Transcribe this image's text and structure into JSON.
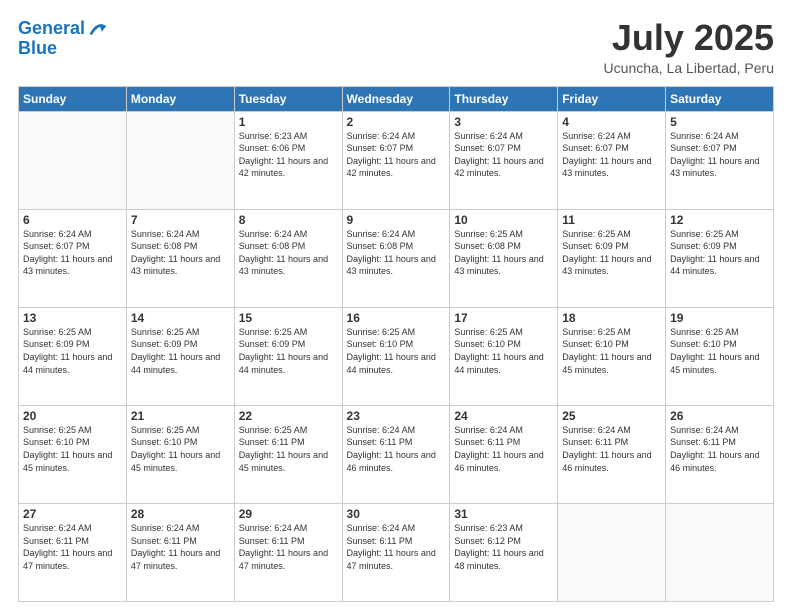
{
  "header": {
    "logo_line1": "General",
    "logo_line2": "Blue",
    "month_title": "July 2025",
    "location": "Ucuncha, La Libertad, Peru"
  },
  "weekdays": [
    "Sunday",
    "Monday",
    "Tuesday",
    "Wednesday",
    "Thursday",
    "Friday",
    "Saturday"
  ],
  "weeks": [
    [
      {
        "day": "",
        "sunrise": "",
        "sunset": "",
        "daylight": ""
      },
      {
        "day": "",
        "sunrise": "",
        "sunset": "",
        "daylight": ""
      },
      {
        "day": "1",
        "sunrise": "Sunrise: 6:23 AM",
        "sunset": "Sunset: 6:06 PM",
        "daylight": "Daylight: 11 hours and 42 minutes."
      },
      {
        "day": "2",
        "sunrise": "Sunrise: 6:24 AM",
        "sunset": "Sunset: 6:07 PM",
        "daylight": "Daylight: 11 hours and 42 minutes."
      },
      {
        "day": "3",
        "sunrise": "Sunrise: 6:24 AM",
        "sunset": "Sunset: 6:07 PM",
        "daylight": "Daylight: 11 hours and 42 minutes."
      },
      {
        "day": "4",
        "sunrise": "Sunrise: 6:24 AM",
        "sunset": "Sunset: 6:07 PM",
        "daylight": "Daylight: 11 hours and 43 minutes."
      },
      {
        "day": "5",
        "sunrise": "Sunrise: 6:24 AM",
        "sunset": "Sunset: 6:07 PM",
        "daylight": "Daylight: 11 hours and 43 minutes."
      }
    ],
    [
      {
        "day": "6",
        "sunrise": "Sunrise: 6:24 AM",
        "sunset": "Sunset: 6:07 PM",
        "daylight": "Daylight: 11 hours and 43 minutes."
      },
      {
        "day": "7",
        "sunrise": "Sunrise: 6:24 AM",
        "sunset": "Sunset: 6:08 PM",
        "daylight": "Daylight: 11 hours and 43 minutes."
      },
      {
        "day": "8",
        "sunrise": "Sunrise: 6:24 AM",
        "sunset": "Sunset: 6:08 PM",
        "daylight": "Daylight: 11 hours and 43 minutes."
      },
      {
        "day": "9",
        "sunrise": "Sunrise: 6:24 AM",
        "sunset": "Sunset: 6:08 PM",
        "daylight": "Daylight: 11 hours and 43 minutes."
      },
      {
        "day": "10",
        "sunrise": "Sunrise: 6:25 AM",
        "sunset": "Sunset: 6:08 PM",
        "daylight": "Daylight: 11 hours and 43 minutes."
      },
      {
        "day": "11",
        "sunrise": "Sunrise: 6:25 AM",
        "sunset": "Sunset: 6:09 PM",
        "daylight": "Daylight: 11 hours and 43 minutes."
      },
      {
        "day": "12",
        "sunrise": "Sunrise: 6:25 AM",
        "sunset": "Sunset: 6:09 PM",
        "daylight": "Daylight: 11 hours and 44 minutes."
      }
    ],
    [
      {
        "day": "13",
        "sunrise": "Sunrise: 6:25 AM",
        "sunset": "Sunset: 6:09 PM",
        "daylight": "Daylight: 11 hours and 44 minutes."
      },
      {
        "day": "14",
        "sunrise": "Sunrise: 6:25 AM",
        "sunset": "Sunset: 6:09 PM",
        "daylight": "Daylight: 11 hours and 44 minutes."
      },
      {
        "day": "15",
        "sunrise": "Sunrise: 6:25 AM",
        "sunset": "Sunset: 6:09 PM",
        "daylight": "Daylight: 11 hours and 44 minutes."
      },
      {
        "day": "16",
        "sunrise": "Sunrise: 6:25 AM",
        "sunset": "Sunset: 6:10 PM",
        "daylight": "Daylight: 11 hours and 44 minutes."
      },
      {
        "day": "17",
        "sunrise": "Sunrise: 6:25 AM",
        "sunset": "Sunset: 6:10 PM",
        "daylight": "Daylight: 11 hours and 44 minutes."
      },
      {
        "day": "18",
        "sunrise": "Sunrise: 6:25 AM",
        "sunset": "Sunset: 6:10 PM",
        "daylight": "Daylight: 11 hours and 45 minutes."
      },
      {
        "day": "19",
        "sunrise": "Sunrise: 6:25 AM",
        "sunset": "Sunset: 6:10 PM",
        "daylight": "Daylight: 11 hours and 45 minutes."
      }
    ],
    [
      {
        "day": "20",
        "sunrise": "Sunrise: 6:25 AM",
        "sunset": "Sunset: 6:10 PM",
        "daylight": "Daylight: 11 hours and 45 minutes."
      },
      {
        "day": "21",
        "sunrise": "Sunrise: 6:25 AM",
        "sunset": "Sunset: 6:10 PM",
        "daylight": "Daylight: 11 hours and 45 minutes."
      },
      {
        "day": "22",
        "sunrise": "Sunrise: 6:25 AM",
        "sunset": "Sunset: 6:11 PM",
        "daylight": "Daylight: 11 hours and 45 minutes."
      },
      {
        "day": "23",
        "sunrise": "Sunrise: 6:24 AM",
        "sunset": "Sunset: 6:11 PM",
        "daylight": "Daylight: 11 hours and 46 minutes."
      },
      {
        "day": "24",
        "sunrise": "Sunrise: 6:24 AM",
        "sunset": "Sunset: 6:11 PM",
        "daylight": "Daylight: 11 hours and 46 minutes."
      },
      {
        "day": "25",
        "sunrise": "Sunrise: 6:24 AM",
        "sunset": "Sunset: 6:11 PM",
        "daylight": "Daylight: 11 hours and 46 minutes."
      },
      {
        "day": "26",
        "sunrise": "Sunrise: 6:24 AM",
        "sunset": "Sunset: 6:11 PM",
        "daylight": "Daylight: 11 hours and 46 minutes."
      }
    ],
    [
      {
        "day": "27",
        "sunrise": "Sunrise: 6:24 AM",
        "sunset": "Sunset: 6:11 PM",
        "daylight": "Daylight: 11 hours and 47 minutes."
      },
      {
        "day": "28",
        "sunrise": "Sunrise: 6:24 AM",
        "sunset": "Sunset: 6:11 PM",
        "daylight": "Daylight: 11 hours and 47 minutes."
      },
      {
        "day": "29",
        "sunrise": "Sunrise: 6:24 AM",
        "sunset": "Sunset: 6:11 PM",
        "daylight": "Daylight: 11 hours and 47 minutes."
      },
      {
        "day": "30",
        "sunrise": "Sunrise: 6:24 AM",
        "sunset": "Sunset: 6:11 PM",
        "daylight": "Daylight: 11 hours and 47 minutes."
      },
      {
        "day": "31",
        "sunrise": "Sunrise: 6:23 AM",
        "sunset": "Sunset: 6:12 PM",
        "daylight": "Daylight: 11 hours and 48 minutes."
      },
      {
        "day": "",
        "sunrise": "",
        "sunset": "",
        "daylight": ""
      },
      {
        "day": "",
        "sunrise": "",
        "sunset": "",
        "daylight": ""
      }
    ]
  ]
}
